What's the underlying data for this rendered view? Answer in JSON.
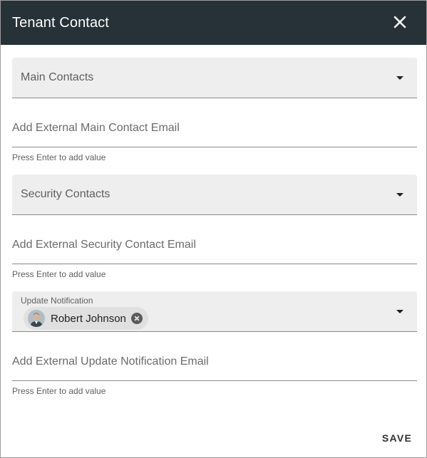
{
  "dialog": {
    "title": "Tenant Contact",
    "close_icon": "close-icon"
  },
  "main_contacts": {
    "label": "Main Contacts",
    "caret_icon": "dropdown-caret-icon"
  },
  "external_main": {
    "placeholder": "Add External Main Contact Email",
    "value": "",
    "hint": "Press Enter to add value"
  },
  "security_contacts": {
    "label": "Security Contacts",
    "caret_icon": "dropdown-caret-icon"
  },
  "external_security": {
    "placeholder": "Add External Security Contact Email",
    "value": "",
    "hint": "Press Enter to add value"
  },
  "update_notification": {
    "label": "Update Notification",
    "caret_icon": "dropdown-caret-icon",
    "chips": [
      {
        "name": "Robert Johnson",
        "avatar_icon": "user-avatar-icon",
        "remove_icon": "remove-chip-icon"
      }
    ]
  },
  "external_update": {
    "placeholder": "Add External Update Notification Email",
    "value": "",
    "hint": "Press Enter to add value"
  },
  "actions": {
    "save_label": "SAVE"
  },
  "colors": {
    "header_bg": "#263238",
    "field_bg": "#eeeeee",
    "chip_bg": "#e0e0e0"
  }
}
